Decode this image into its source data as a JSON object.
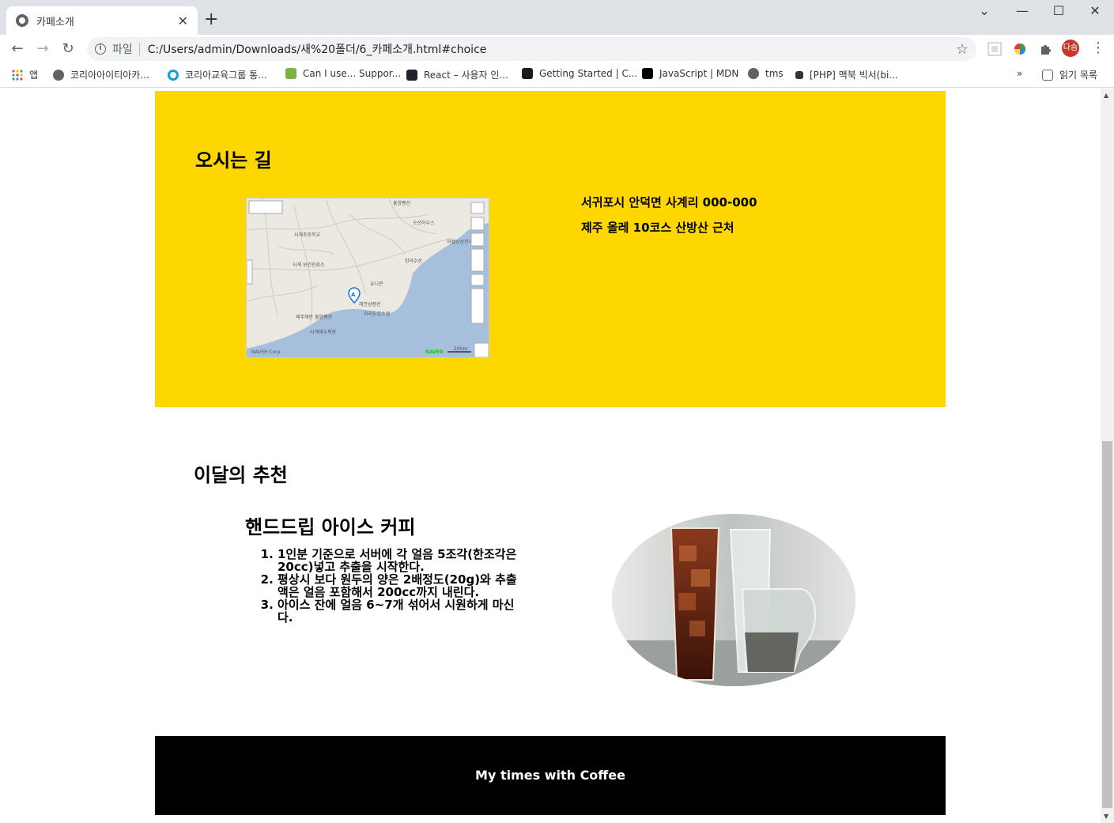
{
  "browser": {
    "tab_title": "카페소개",
    "tab_close": "✕",
    "new_tab": "+",
    "url_scheme": "파일",
    "url": "C:/Users/admin/Downloads/새%20폴더/6_카페소개.html#choice",
    "avatar_text": "다솜",
    "win_min": "—",
    "win_max": "☐",
    "win_close": "✕"
  },
  "bookmarks": [
    {
      "label": "앱",
      "icon_color": "#4285f4"
    },
    {
      "label": "코리아아이티아카...",
      "icon_color": "#5f6368"
    },
    {
      "label": "코리아교육그룹 통...",
      "icon_color": "#1a9bd7"
    },
    {
      "label": "Can I use... Suppor...",
      "icon_color": "#7cb342"
    },
    {
      "label": "React – 사용자 인...",
      "icon_color": "#20232a"
    },
    {
      "label": "Getting Started | C...",
      "icon_color": "#1b1b1b"
    },
    {
      "label": "JavaScript | MDN",
      "icon_color": "#000000"
    },
    {
      "label": "tms",
      "icon_color": "#5f6368"
    },
    {
      "label": "[PHP] 맥북 빅서(bi...",
      "icon_color": "#333333"
    }
  ],
  "bookmarks_more": "»",
  "reading_list": "읽기 목록",
  "directions": {
    "heading": "오시는 길",
    "address_line1": "서귀포시 안덕면 사계리 000-000",
    "address_line2": "제주 올레 10코스 산방산 근처",
    "map_labels": [
      "흥양펜션",
      "오션하우스",
      "사계초등학교",
      "하멜상선전시관",
      "사계 보건진료소",
      "한라수산",
      "유니콘",
      "해안성펜션",
      "마리도김수협",
      "제주해안 흥양펜션",
      "사계해수욕장",
      "NAVER Corp.",
      "NAVER",
      "200m"
    ],
    "bg_color": "#ffd700"
  },
  "recommend": {
    "heading": "이달의 추천",
    "menu_name": "핸드드립 아이스 커피",
    "steps": [
      "1인분 기준으로 서버에 각 얼음 5조각(한조각은 20cc)넣고 추출을 시작한다.",
      "평상시 보다 원두의 양은 2배정도(20g)와 추출액은 얼음 포함해서 200cc까지 내린다.",
      "아이스 잔에 얼음 6~7개 섞어서 시원하게 마신다."
    ]
  },
  "footer": {
    "text": "My times with Coffee"
  }
}
